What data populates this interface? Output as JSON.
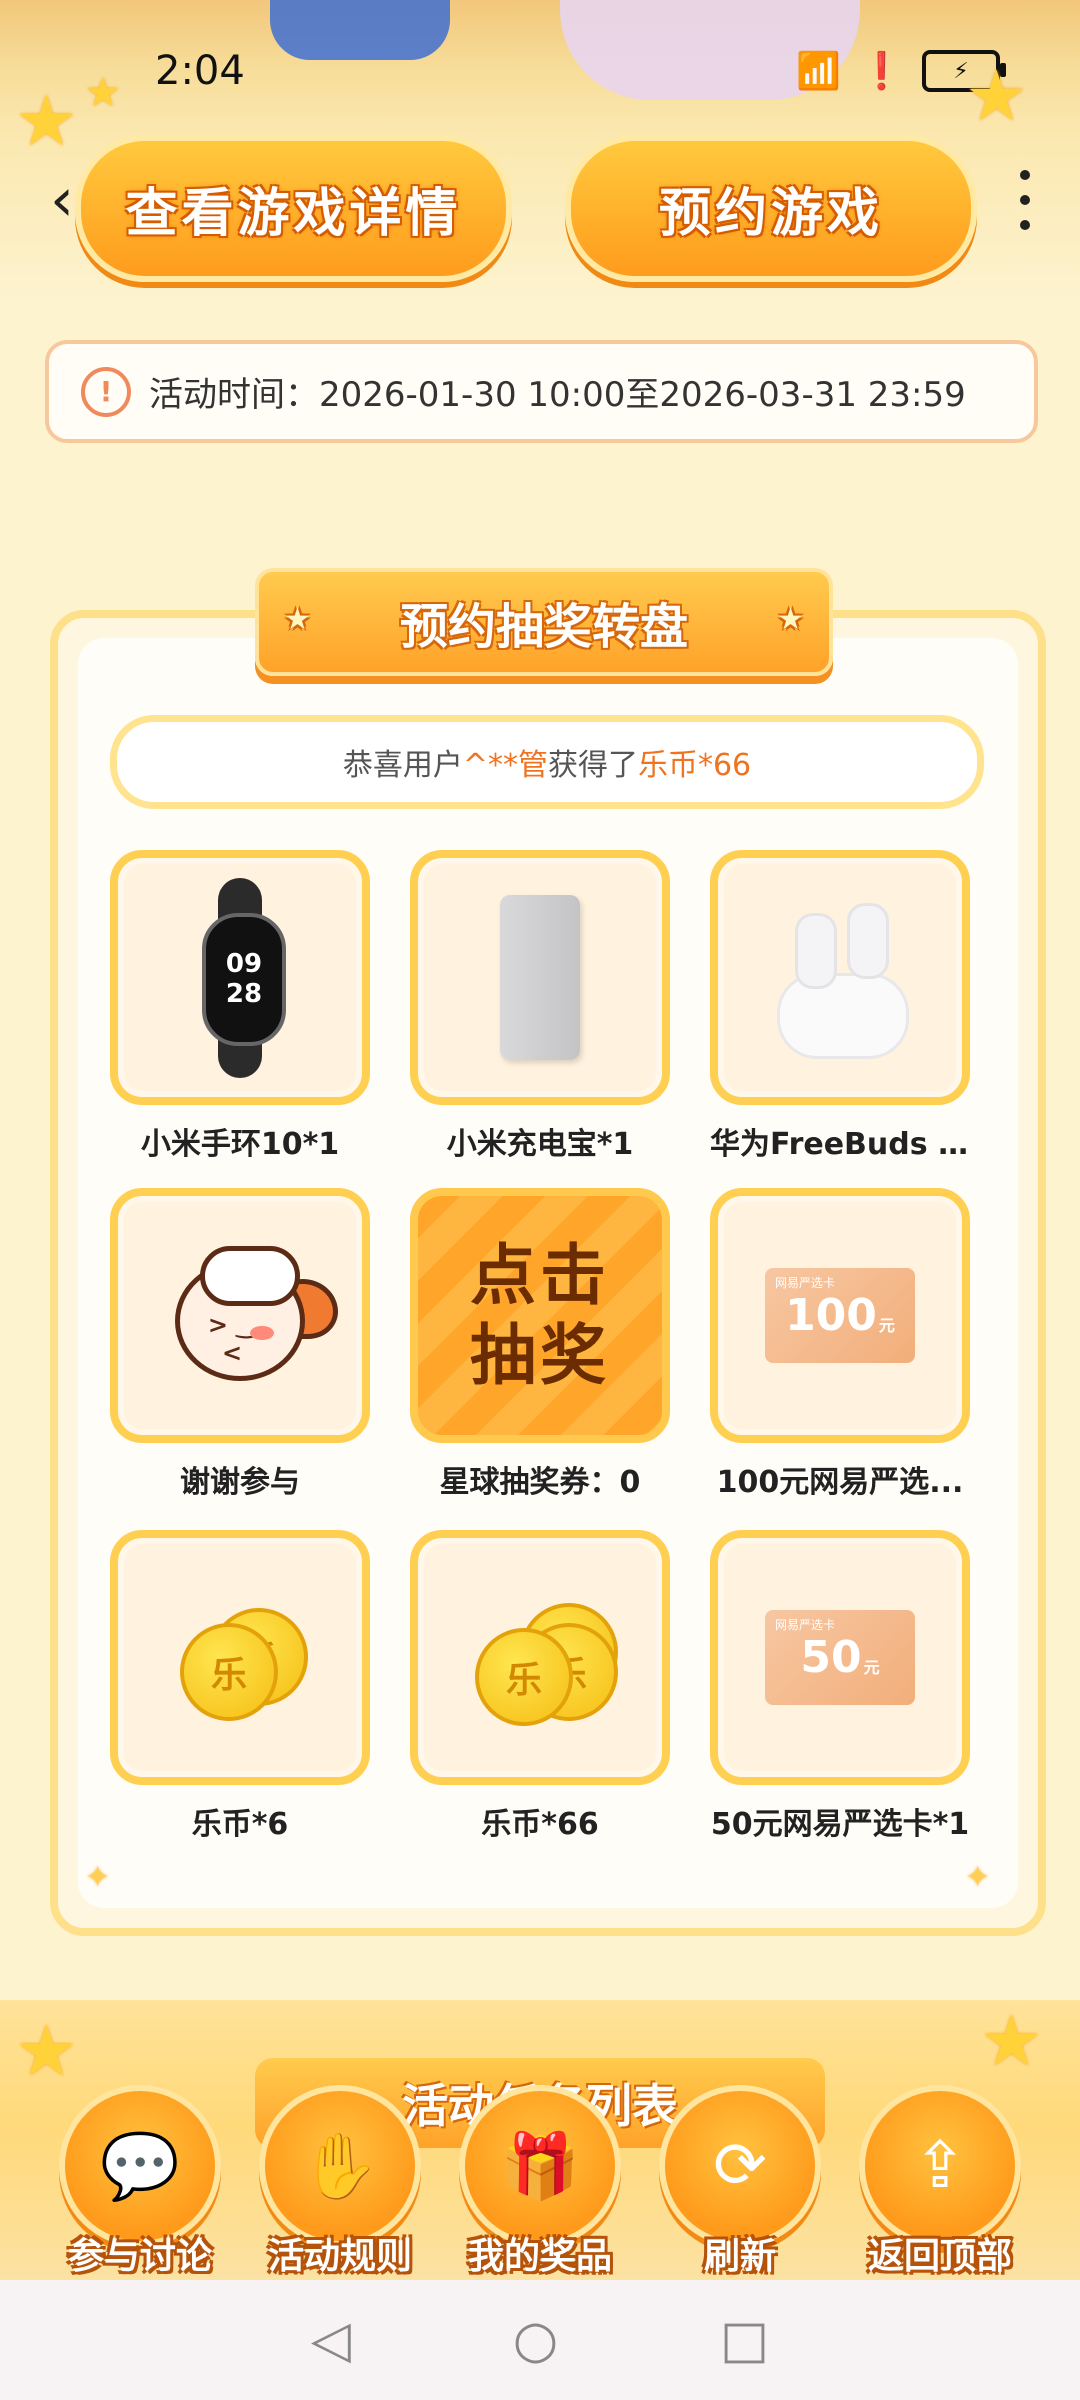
{
  "status_bar": {
    "time": "2:04",
    "battery": "⚡"
  },
  "header": {
    "details_button": "查看游戏详情",
    "reserve_button": "预约游戏"
  },
  "activity_time": {
    "icon": "!",
    "text": "活动时间：2026-01-30 10:00至2026-03-31 23:59"
  },
  "lottery": {
    "title": "预约抽奖转盘",
    "ticker": {
      "prefix": "恭喜用户",
      "user": "^**管",
      "middle": "获得了",
      "prize": "乐币*66"
    },
    "draw_button": {
      "line1": "点击",
      "line2": "抽奖"
    },
    "prizes": [
      {
        "label": "小米手环10*1",
        "icon": "smart-band-icon",
        "band_time_h": "09",
        "band_time_m": "28"
      },
      {
        "label": "小米充电宝*1",
        "icon": "power-bank-icon"
      },
      {
        "label": "华为FreeBuds S...",
        "icon": "earbuds-icon"
      },
      {
        "label": "谢谢参与",
        "icon": "mascot-icon"
      },
      {
        "label": "星球抽奖券：0",
        "icon": "draw-button"
      },
      {
        "label": "100元网易严选...",
        "icon": "voucher-icon",
        "voucher_value": "100",
        "voucher_unit": "元",
        "voucher_tag": "网易严选卡"
      },
      {
        "label": "乐币*6",
        "icon": "coins-icon",
        "coin_glyph": "乐"
      },
      {
        "label": "乐币*66",
        "icon": "coins-icon",
        "coin_glyph": "乐"
      },
      {
        "label": "50元网易严选卡*1",
        "icon": "voucher-icon",
        "voucher_value": "50",
        "voucher_unit": "元",
        "voucher_tag": "网易严选卡"
      }
    ]
  },
  "section2": {
    "title": "活动任务列表"
  },
  "bottom_nav": [
    {
      "label": "参与讨论",
      "icon": "chat-icon"
    },
    {
      "label": "活动规则",
      "icon": "rules-icon"
    },
    {
      "label": "我的奖品",
      "icon": "gift-icon"
    },
    {
      "label": "刷新",
      "icon": "refresh-icon"
    },
    {
      "label": "返回顶部",
      "icon": "back-to-top-icon"
    }
  ],
  "colors": {
    "accent": "#ff9c1d",
    "highlight": "#f0731f",
    "background": "#fdf3cf"
  }
}
